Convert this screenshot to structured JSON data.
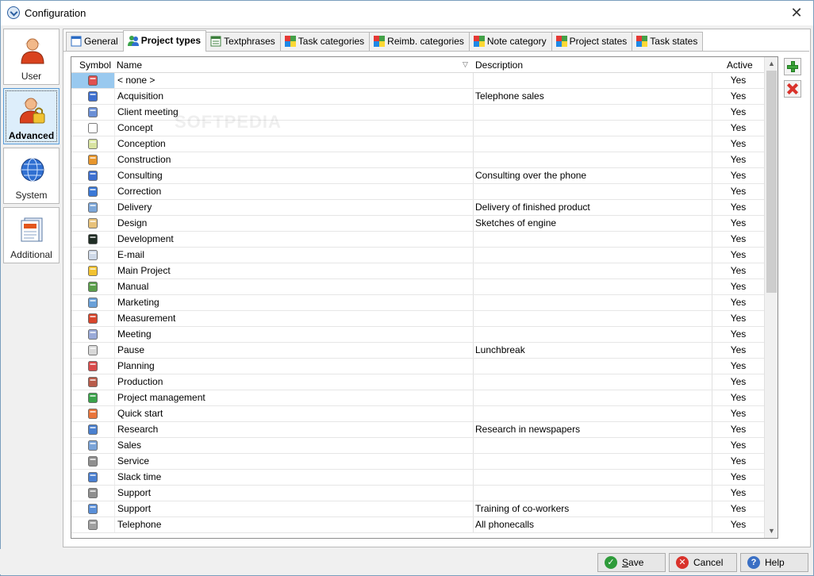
{
  "window": {
    "title": "Configuration",
    "close_glyph": "✕"
  },
  "sidebar": {
    "items": [
      {
        "label": "User",
        "icon": "user-icon",
        "active": false
      },
      {
        "label": "Advanced",
        "icon": "user-lock-icon",
        "active": true
      },
      {
        "label": "System",
        "icon": "globe-icon",
        "active": false
      },
      {
        "label": "Additional",
        "icon": "document-stack-icon",
        "active": false
      }
    ]
  },
  "tabs": [
    {
      "label": "General",
      "icon": "window-icon",
      "active": false
    },
    {
      "label": "Project types",
      "icon": "people-icon",
      "active": true
    },
    {
      "label": "Textphrases",
      "icon": "text-grid-icon",
      "active": false
    },
    {
      "label": "Task categories",
      "icon": "color-squares-icon",
      "active": false
    },
    {
      "label": "Reimb. categories",
      "icon": "color-squares-icon",
      "active": false
    },
    {
      "label": "Note category",
      "icon": "color-squares-icon",
      "active": false
    },
    {
      "label": "Project states",
      "icon": "color-squares-icon",
      "active": false
    },
    {
      "label": "Task states",
      "icon": "color-squares-icon",
      "active": false
    }
  ],
  "grid": {
    "columns": {
      "symbol": "Symbol",
      "name": "Name",
      "description": "Description",
      "active": "Active"
    },
    "sort_glyph": "▽",
    "rows": [
      {
        "icon": "pen-icon",
        "name": "< none >",
        "description": "",
        "active": "Yes",
        "selected": true
      },
      {
        "icon": "handshake-icon",
        "name": "Acquisition",
        "description": "Telephone sales",
        "active": "Yes"
      },
      {
        "icon": "people-icon",
        "name": "Client meeting",
        "description": "",
        "active": "Yes"
      },
      {
        "icon": "document-icon",
        "name": "Concept",
        "description": "",
        "active": "Yes"
      },
      {
        "icon": "flipchart-icon",
        "name": "Conception",
        "description": "",
        "active": "Yes"
      },
      {
        "icon": "truck-icon",
        "name": "Construction",
        "description": "",
        "active": "Yes"
      },
      {
        "icon": "handshake-icon",
        "name": "Consulting",
        "description": "Consulting over the phone",
        "active": "Yes"
      },
      {
        "icon": "brush-icon",
        "name": "Correction",
        "description": "",
        "active": "Yes"
      },
      {
        "icon": "box-icon",
        "name": "Delivery",
        "description": "Delivery of finished product",
        "active": "Yes"
      },
      {
        "icon": "palette-icon",
        "name": "Design",
        "description": "Sketches of engine",
        "active": "Yes"
      },
      {
        "icon": "terminal-icon",
        "name": "Development",
        "description": "",
        "active": "Yes"
      },
      {
        "icon": "mail-icon",
        "name": "E-mail",
        "description": "",
        "active": "Yes"
      },
      {
        "icon": "star-icon",
        "name": "Main Project",
        "description": "",
        "active": "Yes"
      },
      {
        "icon": "books-icon",
        "name": "Manual",
        "description": "",
        "active": "Yes"
      },
      {
        "icon": "chart-icon",
        "name": "Marketing",
        "description": "",
        "active": "Yes"
      },
      {
        "icon": "pencil-icon",
        "name": "Measurement",
        "description": "",
        "active": "Yes"
      },
      {
        "icon": "meeting-icon",
        "name": "Meeting",
        "description": "",
        "active": "Yes"
      },
      {
        "icon": "cup-icon",
        "name": "Pause",
        "description": "Lunchbreak",
        "active": "Yes"
      },
      {
        "icon": "planner-icon",
        "name": "Planning",
        "description": "",
        "active": "Yes"
      },
      {
        "icon": "factory-icon",
        "name": "Production",
        "description": "",
        "active": "Yes"
      },
      {
        "icon": "puzzle-icon",
        "name": "Project management",
        "description": "",
        "active": "Yes"
      },
      {
        "icon": "hand-pointer-icon",
        "name": "Quick start",
        "description": "",
        "active": "Yes"
      },
      {
        "icon": "newspaper-icon",
        "name": "Research",
        "description": "Research in newspapers",
        "active": "Yes"
      },
      {
        "icon": "sales-icon",
        "name": "Sales",
        "description": "",
        "active": "Yes"
      },
      {
        "icon": "headset-icon",
        "name": "Service",
        "description": "",
        "active": "Yes"
      },
      {
        "icon": "hourglass-icon",
        "name": "Slack time",
        "description": "",
        "active": "Yes"
      },
      {
        "icon": "headset-icon",
        "name": "Support",
        "description": "",
        "active": "Yes"
      },
      {
        "icon": "first-aid-icon",
        "name": "Support",
        "description": "Training of co-workers",
        "active": "Yes"
      },
      {
        "icon": "telephone-icon",
        "name": "Telephone",
        "description": "All phonecalls",
        "active": "Yes"
      }
    ]
  },
  "scroll": {
    "up": "▲",
    "down": "▼"
  },
  "actions": {
    "add": "add-icon",
    "delete": "delete-icon"
  },
  "buttons": {
    "save": {
      "accel": "S",
      "rest": "ave"
    },
    "cancel": {
      "label": "Cancel"
    },
    "help": {
      "label": "Help"
    }
  },
  "watermark": "SOFTPEDIA",
  "colors": {
    "selection": "#99c9ef",
    "accent": "#5b9bd5"
  }
}
